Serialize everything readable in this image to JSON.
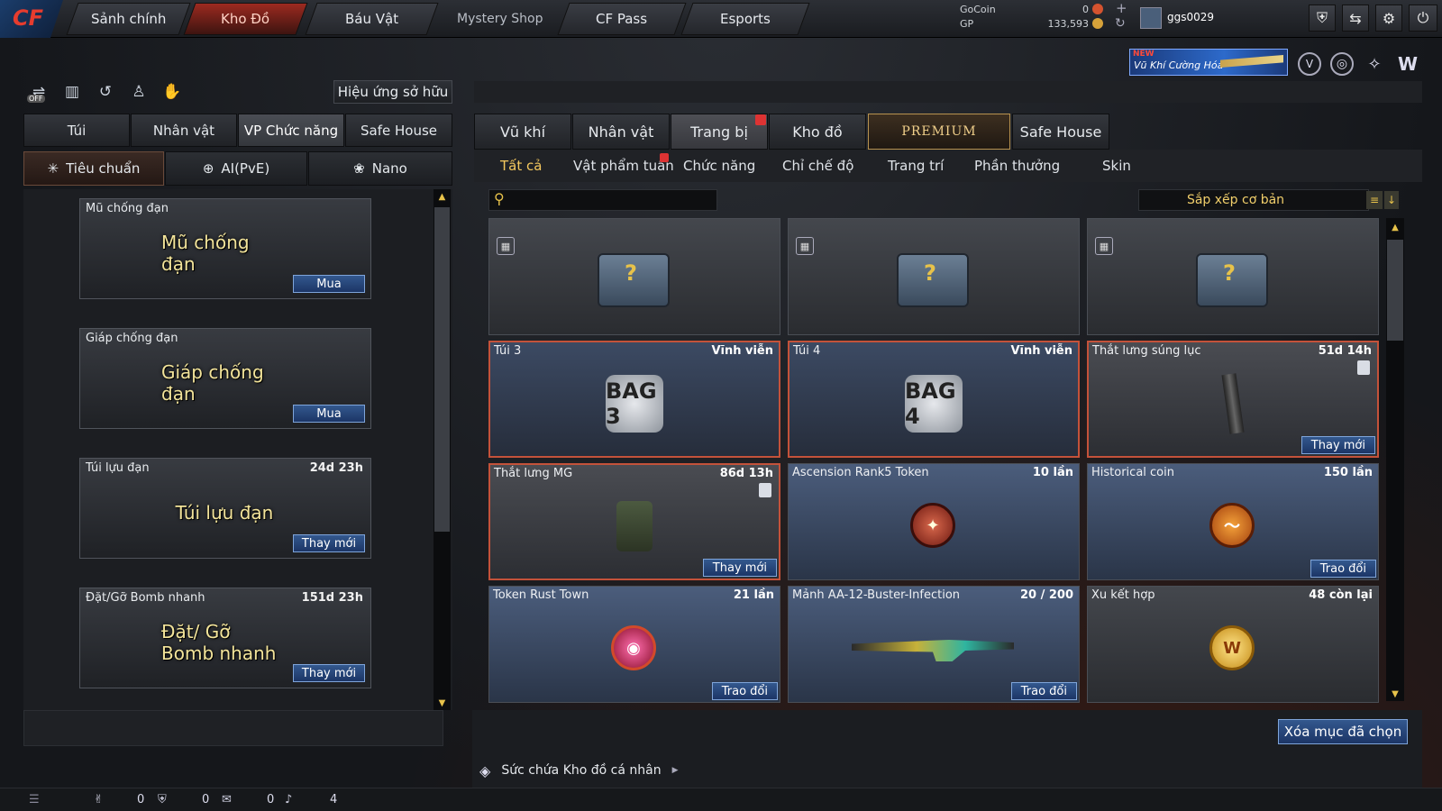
{
  "nav": {
    "tabs": [
      "Sảnh chính",
      "Kho Đồ",
      "Báu Vật",
      "Mystery Shop",
      "CF Pass",
      "Esports"
    ],
    "active_tab": "Kho Đồ"
  },
  "currency": {
    "gocoin_label": "GoCoin",
    "gocoin_value": "0",
    "gp_label": "GP",
    "gp_value": "133,593",
    "username": "ggs0029"
  },
  "banner": {
    "badge": "NEW",
    "text": "Vũ Khí Cường Hóa"
  },
  "left": {
    "effect_button": "Hiệu ứng sở hữu",
    "off_label": "OFF",
    "tabs": [
      "Túi",
      "Nhân vật",
      "VP Chức năng",
      "Safe House"
    ],
    "active_tab": "VP Chức năng",
    "subtabs": [
      "Tiêu chuẩn",
      "AI(PvE)",
      "Nano"
    ],
    "active_subtab": "Tiêu chuẩn",
    "items": [
      {
        "name": "Mũ chống đạn",
        "time": "",
        "art_text": "Mũ chống đạn",
        "action": "Mua"
      },
      {
        "name": "Giáp chống đạn",
        "time": "",
        "art_text": "Giáp chống đạn",
        "action": "Mua"
      },
      {
        "name": "Túi lựu đạn",
        "time": "24d 23h",
        "art_text": "Túi lựu đạn",
        "action": "Thay mới"
      },
      {
        "name": "Đặt/Gỡ Bomb nhanh",
        "time": "151d 23h",
        "art_text": "Đặt/ Gỡ Bomb nhanh",
        "action": "Thay mới"
      }
    ]
  },
  "right": {
    "tabs": [
      "Vũ khí",
      "Nhân vật",
      "Trang bị",
      "Kho đồ",
      "PREMIUM",
      "Safe House"
    ],
    "active_tab": "Trang bị",
    "categories": [
      "Tất cả",
      "Vật phẩm tuần",
      "Chức năng",
      "Chỉ chế độ",
      "Trang trí",
      "Phần thưởng",
      "Skin"
    ],
    "active_category": "Tất cả",
    "search_placeholder": "",
    "sort_label": "Sắp xếp cơ bản",
    "items": [
      {
        "name": "",
        "time": "",
        "action": "",
        "kind": "chest"
      },
      {
        "name": "",
        "time": "",
        "action": "",
        "kind": "chest"
      },
      {
        "name": "",
        "time": "",
        "action": "",
        "kind": "chest"
      },
      {
        "name": "Túi 3",
        "time": "Vĩnh viễn",
        "action": "",
        "kind": "bag",
        "art": "BAG 3"
      },
      {
        "name": "Túi  4",
        "time": "Vĩnh viễn",
        "action": "",
        "kind": "bag",
        "art": "BAG 4"
      },
      {
        "name": "Thắt lưng súng lục",
        "time": "51d 14h",
        "action": "Thay mới",
        "kind": "mag"
      },
      {
        "name": "Thắt lưng MG",
        "time": "86d 13h",
        "action": "Thay mới",
        "kind": "pouch"
      },
      {
        "name": "Ascension Rank5 Token",
        "time": "10 lần",
        "action": "",
        "kind": "token"
      },
      {
        "name": "Historical coin",
        "time": "150 lần",
        "action": "Trao đổi",
        "kind": "coin"
      },
      {
        "name": "Token Rust Town",
        "time": "21 lần",
        "action": "Trao đổi",
        "kind": "orb"
      },
      {
        "name": "Mảnh AA-12-Buster-Infection",
        "time": "20 / 200",
        "action": "Trao đổi",
        "kind": "gun"
      },
      {
        "name": "Xu kết hợp",
        "time": "48 còn lại",
        "action": "",
        "kind": "gold"
      }
    ],
    "clear_button": "Xóa mục đã chọn",
    "capacity_label": "Sức chứa Kho đồ cá nhân"
  },
  "status": {
    "count1": "0",
    "count2": "0",
    "count3": "0",
    "count4": "4"
  }
}
